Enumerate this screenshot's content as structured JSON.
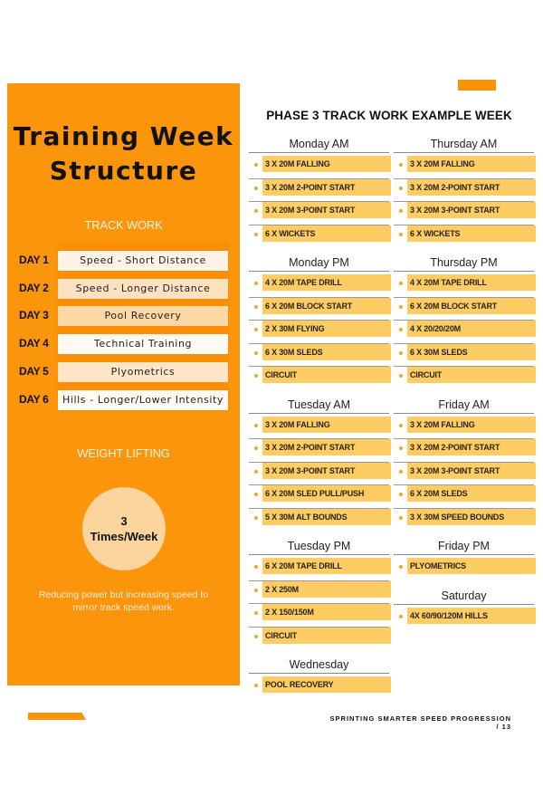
{
  "colors": {
    "accent": "#fb950c",
    "item_bar": "#fdcc63",
    "bullet": "#f0a828",
    "circle": "#fcd49e"
  },
  "panel": {
    "title_line1": "Training Week",
    "title_line2": "Structure",
    "track_work_label": "TRACK WORK",
    "days": [
      {
        "day": "DAY 1",
        "focus": "Speed - Short Distance",
        "bg": "#fdf3e6"
      },
      {
        "day": "DAY 2",
        "focus": "Speed - Longer Distance",
        "bg": "#fde2bf"
      },
      {
        "day": "DAY 3",
        "focus": "Pool Recovery",
        "bg": "#fcd8a6"
      },
      {
        "day": "DAY 4",
        "focus": "Technical Training",
        "bg": "#fffaf4"
      },
      {
        "day": "DAY 5",
        "focus": "Plyometrics",
        "bg": "#fde5c6"
      },
      {
        "day": "DAY 6",
        "focus": "Hills - Longer/Lower Intensity",
        "bg": "#fffaf4"
      }
    ],
    "weight_lifting_label": "WEIGHT LIFTING",
    "frequency_number": "3",
    "frequency_unit": "Times/Week",
    "note": "Reducing power but increasing speed to mirror track speed work."
  },
  "week": {
    "title": "PHASE 3 TRACK WORK EXAMPLE WEEK",
    "left_column": [
      {
        "session": "Monday AM",
        "items": [
          "3 X 20M FALLING",
          "3 X 20M 2-POINT START",
          "3 X 20M 3-POINT START",
          "6 X WICKETS"
        ]
      },
      {
        "session": "Monday PM",
        "items": [
          "4 X 20M TAPE DRILL",
          "6 X 20M BLOCK START",
          "2 X 30M FLYING",
          "6 X 30M SLEDS",
          "CIRCUIT"
        ]
      },
      {
        "session": "Tuesday AM",
        "items": [
          "3 X 20M FALLING",
          "3 X 20M 2-POINT START",
          "3 X 20M 3-POINT START",
          "6 X 20M SLED PULL/PUSH",
          "5 X 30M ALT BOUNDS"
        ]
      },
      {
        "session": "Tuesday PM",
        "items": [
          "6 X 20M TAPE DRILL",
          "2 X 250M",
          "2 X 150/150M",
          "CIRCUIT"
        ]
      },
      {
        "session": "Wednesday",
        "items": [
          "POOL RECOVERY"
        ]
      }
    ],
    "right_column": [
      {
        "session": "Thursday AM",
        "items": [
          "3 X 20M FALLING",
          "3 X 20M 2-POINT START",
          "3 X 20M 3-POINT START",
          "6 X WICKETS"
        ]
      },
      {
        "session": "Thursday PM",
        "items": [
          "4 X 20M TAPE DRILL",
          "6 X 20M BLOCK START",
          "4 X 20/20/20M",
          "6 X 30M SLEDS",
          "CIRCUIT"
        ]
      },
      {
        "session": "Friday AM",
        "items": [
          "3 X 20M FALLING",
          "3 X 20M 2-POINT START",
          "3 X 20M 3-POINT START",
          "6 X 20M SLEDS",
          "3 X 30M SPEED BOUNDS"
        ]
      },
      {
        "session": "Friday PM",
        "items": [
          "PLYOMETRICS"
        ]
      },
      {
        "session": "Saturday",
        "items": [
          "4X 60/90/120M HILLS"
        ]
      }
    ]
  },
  "footer": {
    "text": "SPRINTING SMARTER SPEED PROGRESSION / 13"
  }
}
